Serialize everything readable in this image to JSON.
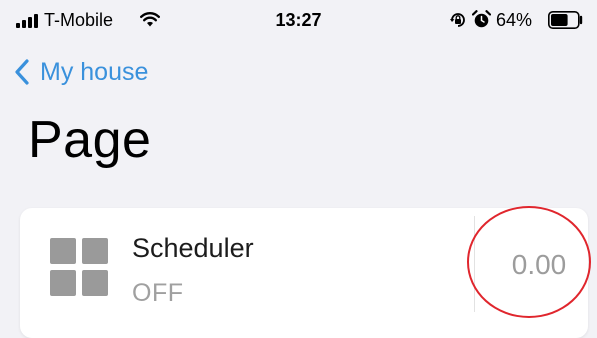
{
  "status_bar": {
    "carrier": "T-Mobile",
    "time": "13:27",
    "battery_percent": "64%",
    "icons": [
      "signal-bars-icon",
      "wifi-icon",
      "rotation-lock-icon",
      "alarm-clock-icon",
      "battery-icon"
    ],
    "battery_level": 0.64
  },
  "nav": {
    "back_label": "My house",
    "back_icon": "chevron-left-icon"
  },
  "page": {
    "title": "Page"
  },
  "card": {
    "icon": "grid-four-squares-icon",
    "title": "Scheduler",
    "status": "OFF",
    "value": "0.00"
  },
  "colors": {
    "accent": "#3a91dc",
    "background": "#f2f2f6",
    "card": "#ffffff",
    "muted_text": "#a0a0a0",
    "annotation": "#e0262d"
  }
}
